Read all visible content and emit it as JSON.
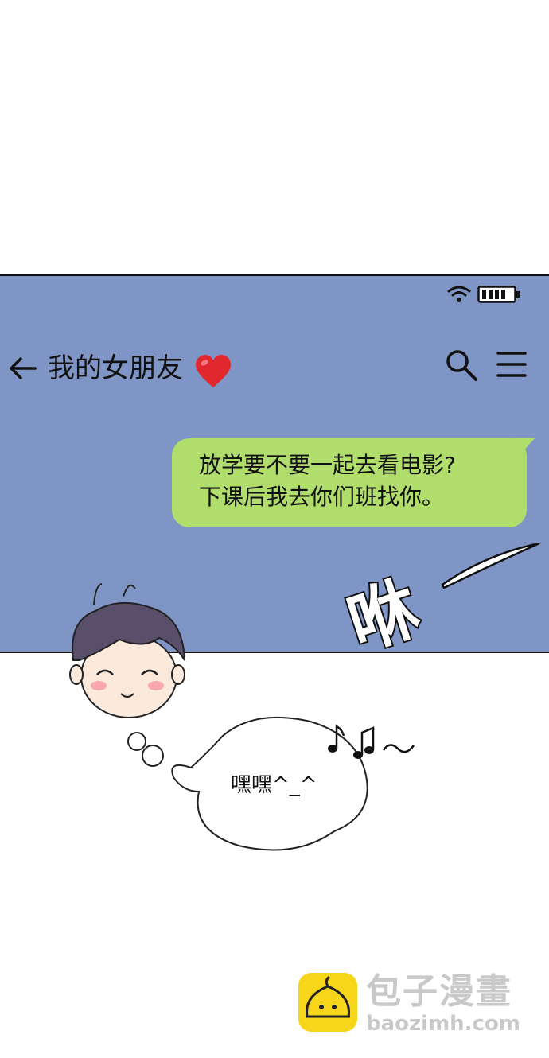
{
  "chat": {
    "title": "我的女朋友",
    "message_line1": "放学要不要一起去看电影?",
    "message_line2": "下课后我去你们班找你。"
  },
  "thought": {
    "text": "嘿嘿^_^"
  },
  "sound_effect": "咻",
  "watermark": {
    "name": "包子漫畫",
    "url": "baozimh.com"
  },
  "colors": {
    "phone_background": "#7f95c6",
    "message_bubble": "#b0dd6c"
  },
  "icons": [
    "wifi-icon",
    "battery-icon",
    "back-arrow-icon",
    "heart-icon",
    "search-icon",
    "menu-icon"
  ]
}
